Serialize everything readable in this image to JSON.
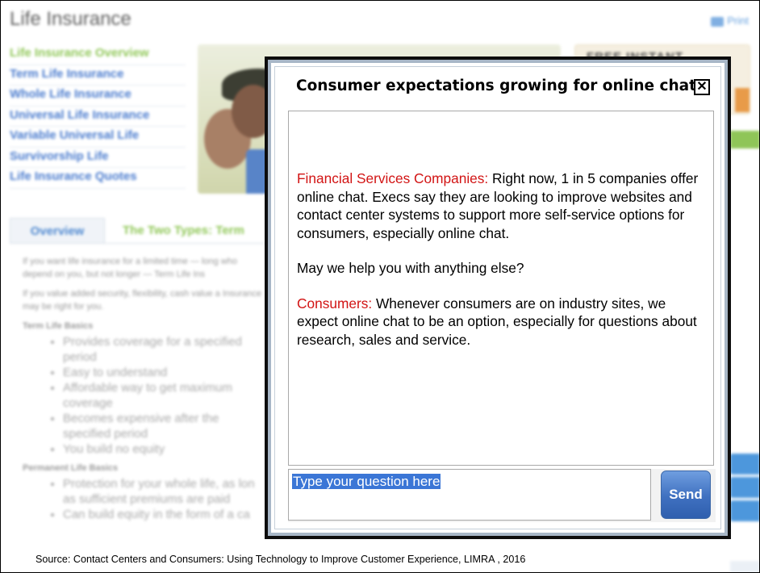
{
  "background": {
    "title": "Life Insurance",
    "print_label": "Print",
    "nav": [
      {
        "label": "Life Insurance Overview",
        "active": true
      },
      {
        "label": "Term Life Insurance",
        "active": false
      },
      {
        "label": "Whole Life Insurance",
        "active": false
      },
      {
        "label": "Universal Life Insurance",
        "active": false
      },
      {
        "label": "Variable Universal Life",
        "active": false
      },
      {
        "label": "Survivorship Life",
        "active": false
      },
      {
        "label": "Life Insurance Quotes",
        "active": false
      }
    ],
    "promo_text": "FREE INSTANT",
    "tabs": [
      "Overview",
      "The Two Types: Term"
    ],
    "paragraphs": [
      "If you want life insurance for a limited time — long who depend on you, but not longer — Term Life Ins",
      "If you value added security, flexibility, cash value a Insurance may be right for you."
    ],
    "term_basics_heading": "Term Life Basics",
    "term_basics": [
      "Provides coverage for a specified period",
      "Easy to understand",
      "Affordable way to get maximum coverage",
      "Becomes expensive after the specified period",
      "You build no equity"
    ],
    "permanent_basics_heading": "Permanent Life Basics",
    "permanent_basics": [
      "Protection for your whole life, as lon as sufficient premiums are paid",
      "Can build equity in the form of a ca"
    ]
  },
  "chat": {
    "title": "Consumer expectations growing for online chat",
    "messages": [
      {
        "speaker": "Financial Services Companies:",
        "text": " Right now, 1 in 5 companies offer online chat. Execs say they are looking to improve websites and contact center systems to support more self-service options for consumers, especially online chat."
      },
      {
        "speaker": "",
        "text": "May we help you with anything else?"
      },
      {
        "speaker": "Consumers:",
        "text": " Whenever consumers are on industry sites,  we expect online chat to be an option, especially for questions about research, sales and service."
      }
    ],
    "input_text": "Type your question here",
    "send_label": "Send"
  },
  "source": "Source: Contact Centers and Consumers: Using Technology to Improve Customer Experience, LIMRA , 2016",
  "colors": {
    "speaker": "#d21414",
    "send_button": "#3f70c0",
    "nav_link": "#2a64c5",
    "nav_active": "#7cbd3a"
  },
  "icons": {
    "close": "close-icon",
    "print": "printer-icon"
  }
}
